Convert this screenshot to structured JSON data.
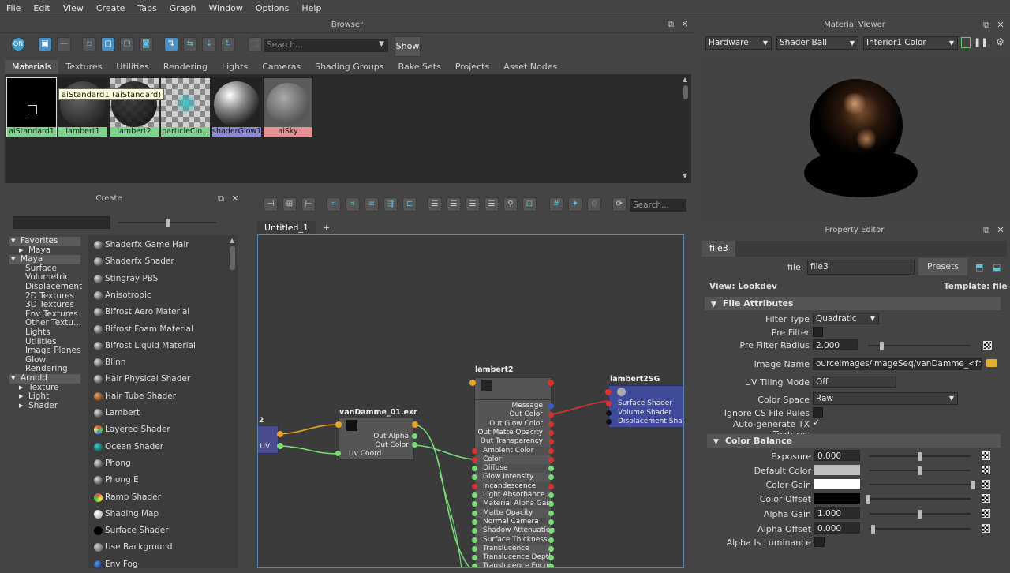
{
  "menu": [
    "File",
    "Edit",
    "View",
    "Create",
    "Tabs",
    "Graph",
    "Window",
    "Options",
    "Help"
  ],
  "browser": {
    "title": "Browser",
    "search_placeholder": "Search...",
    "show_label": "Show",
    "tabs": [
      "Materials",
      "Textures",
      "Utilities",
      "Rendering",
      "Lights",
      "Cameras",
      "Shading Groups",
      "Bake Sets",
      "Projects",
      "Asset Nodes"
    ],
    "swatches": [
      "aiStandard1",
      "lambert1",
      "lambert2",
      "particleClo...",
      "shaderGlow1",
      "aiSky"
    ],
    "tooltip": "aiStandard1 (aiStandard)"
  },
  "create": {
    "title": "Create",
    "tree": [
      {
        "label": "Favorites",
        "hdr": true,
        "exp": "▼"
      },
      {
        "label": "Maya",
        "hdr": false,
        "exp": "▶",
        "indent": 1
      },
      {
        "label": "Maya",
        "hdr": true,
        "exp": "▼"
      },
      {
        "label": "Surface",
        "indent": 2
      },
      {
        "label": "Volumetric",
        "indent": 2
      },
      {
        "label": "Displacement",
        "indent": 2
      },
      {
        "label": "2D Textures",
        "indent": 2
      },
      {
        "label": "3D Textures",
        "indent": 2
      },
      {
        "label": "Env Textures",
        "indent": 2
      },
      {
        "label": "Other Textu...",
        "indent": 2
      },
      {
        "label": "Lights",
        "indent": 2
      },
      {
        "label": "Utilities",
        "indent": 2
      },
      {
        "label": "Image Planes",
        "indent": 2
      },
      {
        "label": "Glow",
        "indent": 2
      },
      {
        "label": "Rendering",
        "indent": 2
      },
      {
        "label": "Arnold",
        "hdr": true,
        "exp": "▼"
      },
      {
        "label": "Texture",
        "exp": "▶",
        "indent": 1
      },
      {
        "label": "Light",
        "exp": "▶",
        "indent": 1
      },
      {
        "label": "Shader",
        "exp": "▶",
        "indent": 1
      }
    ],
    "nodes": [
      "Shaderfx Game Hair",
      "Shaderfx Shader",
      "Stingray PBS",
      "Anisotropic",
      "Bifrost Aero Material",
      "Bifrost Foam Material",
      "Bifrost Liquid Material",
      "Blinn",
      "Hair Physical Shader",
      "Hair Tube Shader",
      "Lambert",
      "Layered Shader",
      "Ocean Shader",
      "Phong",
      "Phong E",
      "Ramp Shader",
      "Shading Map",
      "Surface Shader",
      "Use Background",
      "Env Fog"
    ]
  },
  "graph": {
    "tab": "Untitled_1",
    "add_tab": "+",
    "search_placeholder": "Search...",
    "left_node_num": "2",
    "left_node_port": "t UV",
    "file_node": {
      "title": "vanDamme_01.exr",
      "ports": [
        "Out Alpha",
        "Out Color",
        "Uv Coord"
      ]
    },
    "lambert_node": {
      "title": "lambert2",
      "ports": [
        "Message",
        "Out Color",
        "Out Glow Color",
        "Out Matte Opacity",
        "Out Transparency",
        "Ambient Color",
        "Color",
        "Diffuse",
        "Glow Intensity",
        "Incandescence",
        "Light Absorbance",
        "Material Alpha Gain",
        "Matte Opacity",
        "Normal Camera",
        "Shadow Attenuation",
        "Surface Thickness",
        "Translucence",
        "Translucence Depth",
        "Translucence Focus"
      ]
    },
    "sg_node": {
      "title": "lambert2SG",
      "ports": [
        "Surface Shader",
        "Volume Shader",
        "Displacement Shader"
      ]
    }
  },
  "viewer": {
    "title": "Material Viewer",
    "renderer": "Hardware",
    "geometry": "Shader Ball",
    "environment": "Interior1 Color"
  },
  "property_editor": {
    "title": "Property Editor",
    "tab": "file3",
    "file_label": "file:",
    "file_value": "file3",
    "presets_label": "Presets",
    "view_label": "View: Lookdev",
    "template_label": "Template: file",
    "section_file": "File Attributes",
    "section_color": "Color Balance",
    "filter_type_label": "Filter Type",
    "filter_type_value": "Quadratic",
    "pre_filter_label": "Pre Filter",
    "pre_filter_radius_label": "Pre Filter Radius",
    "pre_filter_radius_value": "2.000",
    "image_name_label": "Image Name",
    "image_name_value": "ourceimages/imageSeq/vanDamme_<f>.exr",
    "uv_tiling_label": "UV Tiling Mode",
    "uv_tiling_value": "Off",
    "color_space_label": "Color Space",
    "color_space_value": "Raw",
    "ignore_cs_label": "Ignore CS File Rules",
    "auto_tx_label": "Auto-generate TX Textures",
    "auto_tx_check": "✓",
    "exposure_label": "Exposure",
    "exposure_value": "0.000",
    "default_color_label": "Default Color",
    "color_gain_label": "Color Gain",
    "color_offset_label": "Color Offset",
    "alpha_gain_label": "Alpha Gain",
    "alpha_gain_value": "1.000",
    "alpha_offset_label": "Alpha Offset",
    "alpha_offset_value": "0.000",
    "alpha_lum_label": "Alpha Is Luminance"
  }
}
